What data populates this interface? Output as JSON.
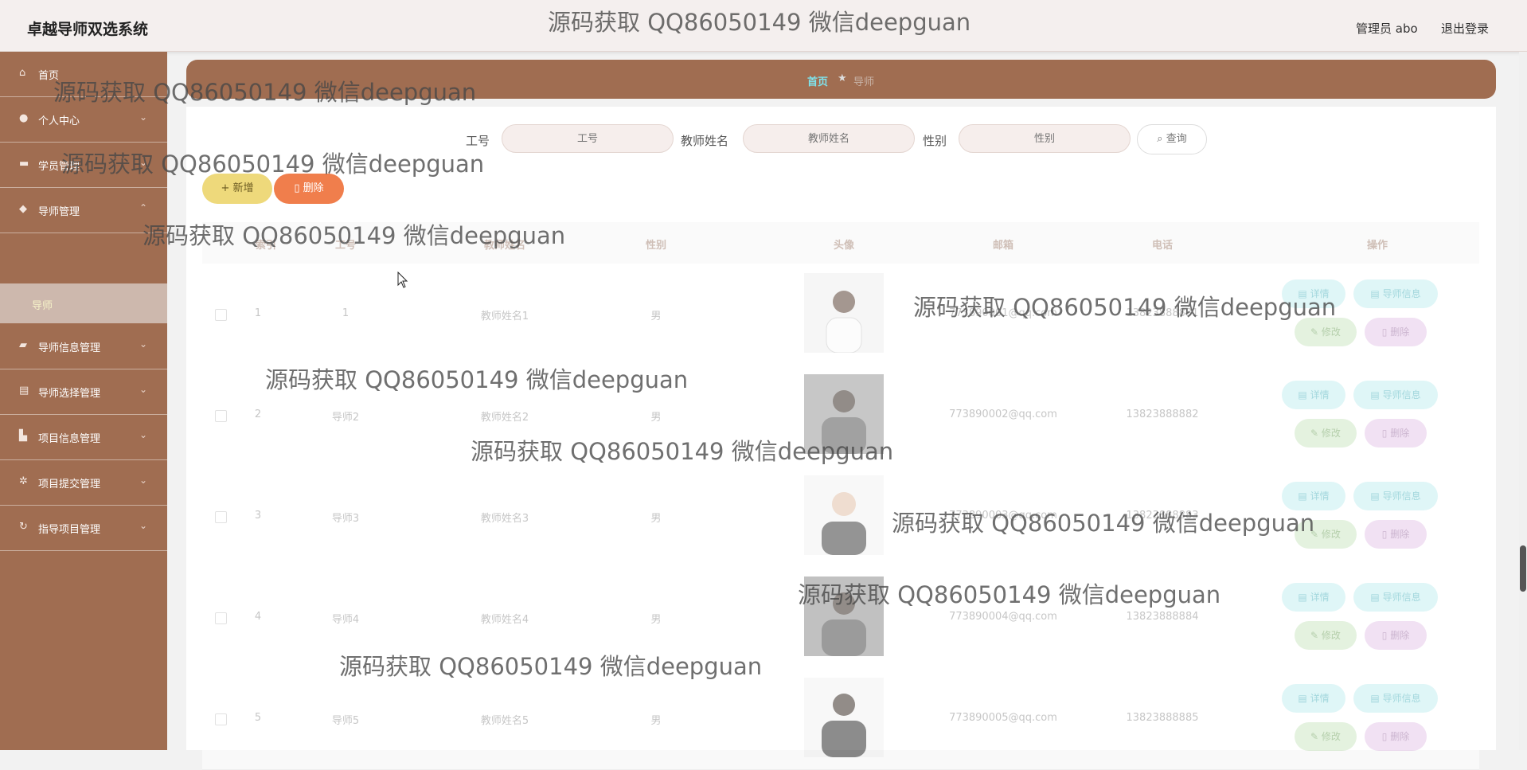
{
  "header": {
    "title": "卓越导师双选系统",
    "user": "管理员 abo",
    "logout": "退出登录"
  },
  "sidebar": {
    "items": [
      {
        "label": "首页",
        "icon": "home-icon"
      },
      {
        "label": "个人中心",
        "icon": "user-icon"
      },
      {
        "label": "学员管理",
        "icon": "briefcase-icon"
      },
      {
        "label": "导师管理",
        "icon": "shield-icon"
      },
      {
        "label": "导师信息管理",
        "icon": "folder-icon"
      },
      {
        "label": "导师选择管理",
        "icon": "clipboard-icon"
      },
      {
        "label": "项目信息管理",
        "icon": "building-icon"
      },
      {
        "label": "项目提交管理",
        "icon": "gear-icon"
      },
      {
        "label": "指导项目管理",
        "icon": "refresh-icon"
      }
    ],
    "sub_item": "导师"
  },
  "breadcrumb": {
    "home": "首页",
    "separator": "★",
    "current": "导师"
  },
  "search": {
    "id_label": "工号",
    "id_placeholder": "工号",
    "name_label": "教师姓名",
    "name_placeholder": "教师姓名",
    "gender_label": "性别",
    "gender_placeholder": "性别",
    "query": "查询"
  },
  "toolbar": {
    "add": "新增",
    "delete": "删除"
  },
  "table": {
    "headers": [
      "索引",
      "工号",
      "教师姓名",
      "性别",
      "头像",
      "邮箱",
      "电话",
      "操作"
    ],
    "rows": [
      {
        "index": "1",
        "id": "1",
        "name": "教师姓名1",
        "gender": "男",
        "email": "773890001@qq.com",
        "phone": "13823888881"
      },
      {
        "index": "2",
        "id": "导师2",
        "name": "教师姓名2",
        "gender": "男",
        "email": "773890002@qq.com",
        "phone": "13823888882"
      },
      {
        "index": "3",
        "id": "导师3",
        "name": "教师姓名3",
        "gender": "男",
        "email": "773890003@qq.com",
        "phone": "13823888883"
      },
      {
        "index": "4",
        "id": "导师4",
        "name": "教师姓名4",
        "gender": "男",
        "email": "773890004@qq.com",
        "phone": "13823888884"
      },
      {
        "index": "5",
        "id": "导师5",
        "name": "教师姓名5",
        "gender": "男",
        "email": "773890005@qq.com",
        "phone": "13823888885"
      }
    ],
    "actions": {
      "detail": "详情",
      "info": "导师信息",
      "edit": "修改",
      "remove": "删除"
    }
  },
  "watermark": "源码获取 QQ86050149 微信deepguan",
  "colors": {
    "sidebar": "#a06d51",
    "header": "#f4efee",
    "add_button": "#eed97b",
    "delete_button": "#f07e4c",
    "breadcrumb_home": "#7fe3ec"
  }
}
